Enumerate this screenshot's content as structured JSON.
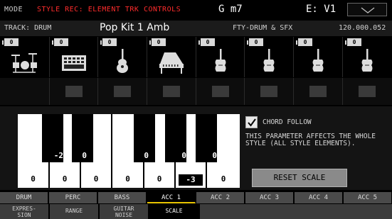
{
  "header": {
    "mode_label": "MODE",
    "mode_value": "STYLE REC: ELEMENT TRK CONTROLS",
    "chord": "G m7",
    "variation": "E: V1",
    "dropdown_icon": "chevron-down-icon"
  },
  "track": {
    "label": "TRACK: DRUM",
    "sound": "Pop Kit 1 Amb",
    "bank": "FTY-DRUM & SFX",
    "number": "120.000.052"
  },
  "slots": [
    {
      "channel": "0",
      "icon": "drum-kit-icon"
    },
    {
      "channel": "0",
      "icon": "keyboard-instrument-icon"
    },
    {
      "channel": "0",
      "icon": "guitar-icon"
    },
    {
      "channel": "0",
      "icon": "piano-icon"
    },
    {
      "channel": "0",
      "icon": "violin-icon"
    },
    {
      "channel": "0",
      "icon": "violin-icon"
    },
    {
      "channel": "0",
      "icon": "violin-icon"
    },
    {
      "channel": "0",
      "icon": "violin-icon"
    }
  ],
  "scale": {
    "white_values": [
      "0",
      "0",
      "0",
      "0",
      "0",
      "-3",
      "0"
    ],
    "black_values": [
      "-2",
      "0",
      "0",
      "0",
      "0"
    ],
    "selected_key_index": 5
  },
  "chord_follow": {
    "label": "CHORD FOLLOW",
    "checked": true
  },
  "note": "THIS PARAMETER AFFECTS THE WHOLE STYLE (ALL STYLE ELEMENTS).",
  "reset_button": "RESET SCALE",
  "tabs_tracks": [
    "DRUM",
    "PERC",
    "BASS",
    "ACC 1",
    "ACC 2",
    "ACC 3",
    "ACC 4",
    "ACC 5"
  ],
  "active_track_tab": "ACC 1",
  "tabs_params": [
    {
      "line1": "EXPRES-",
      "line2": "SION"
    },
    {
      "line1": "RANGE",
      "line2": ""
    },
    {
      "line1": "GUITAR",
      "line2": "NOISE"
    },
    {
      "line1": "SCALE",
      "line2": ""
    }
  ],
  "active_param_tab": "SCALE",
  "colors": {
    "mode_value": "#ff2c2c",
    "active_tab_underline": "#e8c400"
  }
}
